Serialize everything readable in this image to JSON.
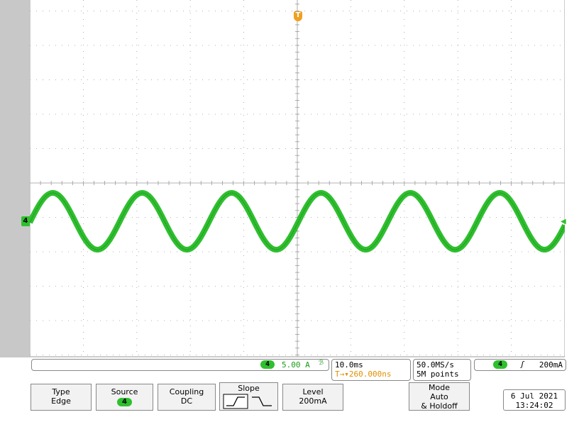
{
  "colors": {
    "trace": "#2fbf2f",
    "trace_dark": "#1d8f1d",
    "trigger": "#f0a020",
    "grid": "#9a9a9a"
  },
  "markers": {
    "channel": "4",
    "trigger": "T"
  },
  "status": {
    "channel_badge": "4",
    "scale": "5.00 A",
    "bandwidth_icon": "bandwidth-limit-icon",
    "timebase": "10.0ms",
    "trigger_offset_icon": "T→▾",
    "trigger_offset": "260.000ns",
    "sample_rate": "50.0MS/s",
    "record_length": "5M points",
    "trigger_channel": "4",
    "trigger_slope_icon": "rising-edge-icon",
    "trigger_level": "200mA"
  },
  "menu": {
    "type": {
      "title": "Type",
      "value": "Edge"
    },
    "source": {
      "title": "Source",
      "value": "4"
    },
    "coupling": {
      "title": "Coupling",
      "value": "DC"
    },
    "slope": {
      "title": "Slope"
    },
    "level": {
      "title": "Level",
      "value": "200mA"
    },
    "mode": {
      "title": "Mode",
      "line2": "Auto",
      "line3": "& Holdoff"
    }
  },
  "datetime": {
    "date": "6 Jul  2021",
    "time": "13:24:02"
  }
}
